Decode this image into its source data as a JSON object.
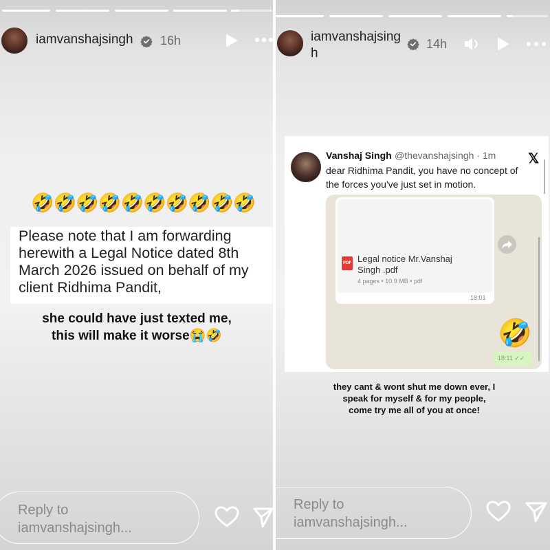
{
  "colors": {
    "panel_bg": "#e8e8e8",
    "progress_bar": "#ffffff",
    "text_dark": "#222222",
    "text_muted": "#6b6b6b",
    "whatsapp_bg": "#e9e4d8",
    "pdf_red": "#e53935"
  },
  "story1": {
    "progress": [
      1,
      1,
      1,
      1,
      0.2
    ],
    "username": "iamvanshajsingh",
    "verified_icon": "verified-badge-icon",
    "time": "16h",
    "emoji_row": "🤣🤣🤣🤣🤣🤣🤣🤣🤣🤣",
    "notice_text": "Please note that I am forwarding herewith a Legal Notice dated 8th March 2026 issued on behalf of my client Ridhima Pandit,",
    "caption_line1": "she could have just texted me,",
    "caption_line2": "this will make it worse😭🤣",
    "reply_line1": "Reply to",
    "reply_line2": "iamvanshajsingh..."
  },
  "story2": {
    "progress": [
      1,
      1,
      1,
      1,
      0.15
    ],
    "username_line1": "iamvanshajsing",
    "username_line2": "h",
    "time": "14h",
    "tweet": {
      "name": "Vanshaj Singh",
      "handle_time": "@thevanshajsingh · 1m",
      "text": "dear Ridhima Pandit, you have no concept of the forces you've just set in motion.",
      "x_logo": "𝕏",
      "doc_badge": "PDF",
      "doc_title": "Legal notice Mr.Vanshaj Singh .pdf",
      "doc_meta": "4 pages • 10.9 MB • pdf",
      "doc_time": "18:01",
      "emoji": "🤣",
      "sent_time": "18:11 ✓✓"
    },
    "caption_line1": "they cant & wont shut me down ever, I",
    "caption_line2": "speak for myself & for my people,",
    "caption_line3": "come try me all of you at once!",
    "reply_line1": "Reply to",
    "reply_line2": "iamvanshajsingh..."
  }
}
